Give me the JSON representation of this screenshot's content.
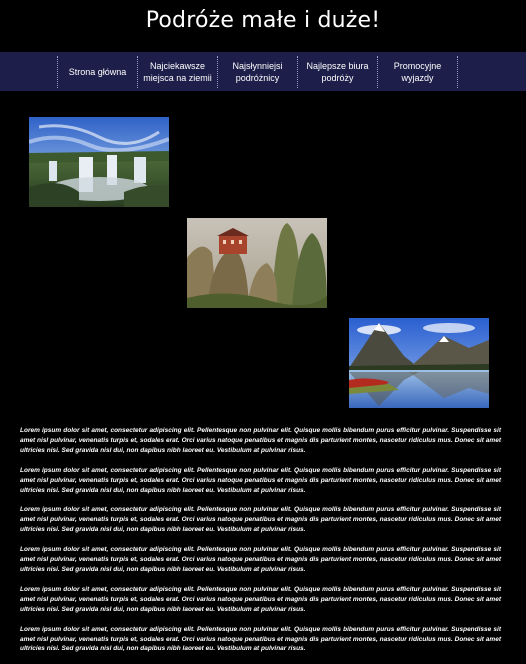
{
  "header": {
    "title": "Podróże małe i duże!"
  },
  "nav": {
    "items": [
      {
        "label": "Strona główna"
      },
      {
        "label": "Najciekawsze miejsca na ziemii"
      },
      {
        "label": "Najsłynniejsi podróżnicy"
      },
      {
        "label": "Najlepsze biura podróży"
      },
      {
        "label": "Promocyjne wyjazdy"
      }
    ]
  },
  "gallery": [
    {
      "icon": "waterfall-photo"
    },
    {
      "icon": "cliff-monastery-photo"
    },
    {
      "icon": "mountain-lake-photo"
    }
  ],
  "article": {
    "paragraphs": [
      "Lorem ipsum dolor sit amet, consectetur adipiscing elit. Pellentesque non pulvinar elit. Quisque mollis bibendum purus efficitur pulvinar. Suspendisse sit amet nisl pulvinar, venenatis turpis et, sodales erat. Orci varius natoque penatibus et magnis dis parturient montes, nascetur ridiculus mus. Donec sit amet ultricies nisi. Sed gravida nisl dui, non dapibus nibh laoreet eu. Vestibulum at pulvinar risus.",
      "Lorem ipsum dolor sit amet, consectetur adipiscing elit. Pellentesque non pulvinar elit. Quisque mollis bibendum purus efficitur pulvinar. Suspendisse sit amet nisl pulvinar, venenatis turpis et, sodales erat. Orci varius natoque penatibus et magnis dis parturient montes, nascetur ridiculus mus. Donec sit amet ultricies nisi. Sed gravida nisl dui, non dapibus nibh laoreet eu. Vestibulum at pulvinar risus.",
      "Lorem ipsum dolor sit amet, consectetur adipiscing elit. Pellentesque non pulvinar elit. Quisque mollis bibendum purus efficitur pulvinar. Suspendisse sit amet nisl pulvinar, venenatis turpis et, sodales erat. Orci varius natoque penatibus et magnis dis parturient montes, nascetur ridiculus mus. Donec sit amet ultricies nisi. Sed gravida nisl dui, non dapibus nibh laoreet eu. Vestibulum at pulvinar risus.",
      "Lorem ipsum dolor sit amet, consectetur adipiscing elit. Pellentesque non pulvinar elit. Quisque mollis bibendum purus efficitur pulvinar. Suspendisse sit amet nisl pulvinar, venenatis turpis et, sodales erat. Orci varius natoque penatibus et magnis dis parturient montes, nascetur ridiculus mus. Donec sit amet ultricies nisi. Sed gravida nisl dui, non dapibus nibh laoreet eu. Vestibulum at pulvinar risus.",
      "Lorem ipsum dolor sit amet, consectetur adipiscing elit. Pellentesque non pulvinar elit. Quisque mollis bibendum purus efficitur pulvinar. Suspendisse sit amet nisl pulvinar, venenatis turpis et, sodales erat. Orci varius natoque penatibus et magnis dis parturient montes, nascetur ridiculus mus. Donec sit amet ultricies nisi. Sed gravida nisl dui, non dapibus nibh laoreet eu. Vestibulum at pulvinar risus.",
      "Lorem ipsum dolor sit amet, consectetur adipiscing elit. Pellentesque non pulvinar elit. Quisque mollis bibendum purus efficitur pulvinar. Suspendisse sit amet nisl pulvinar, venenatis turpis et, sodales erat. Orci varius natoque penatibus et magnis dis parturient montes, nascetur ridiculus mus. Donec sit amet ultricies nisi. Sed gravida nisl dui, non dapibus nibh laoreet eu. Vestibulum at pulvinar risus."
    ]
  },
  "colors": {
    "background": "#000000",
    "nav_background": "#1d1f4a",
    "text": "#ffffff"
  }
}
